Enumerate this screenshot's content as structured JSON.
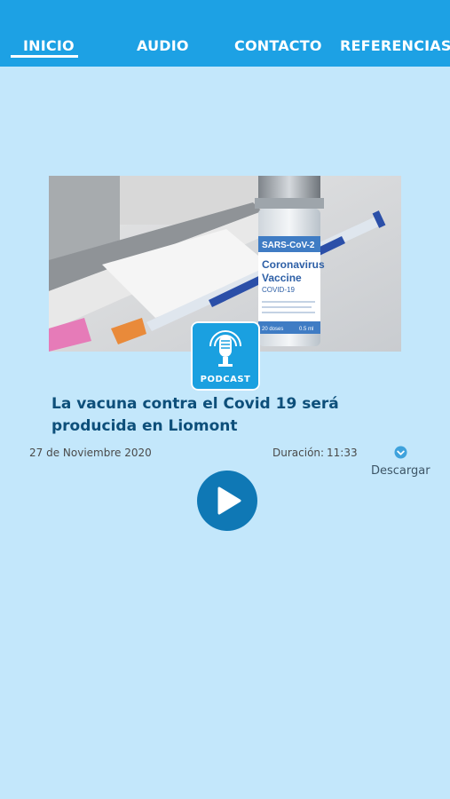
{
  "nav": {
    "items": [
      {
        "label": "INICIO",
        "active": true
      },
      {
        "label": "AUDIO",
        "active": false
      },
      {
        "label": "CONTACTO",
        "active": false
      },
      {
        "label": "REFERENCIAS",
        "active": false
      }
    ]
  },
  "hero": {
    "vial_label_top": "SARS-CoV-2",
    "vial_label_main_1": "Coronavirus",
    "vial_label_main_2": "Vaccine",
    "vial_label_sub": "COVID-19",
    "vial_doses": "20 doses",
    "vial_ml": "0.5 ml"
  },
  "badge": {
    "label": "PODCAST",
    "icon": "microphone-icon"
  },
  "episode": {
    "title": "La vacuna contra el Covid 19 será producida en Liomont",
    "date": "27 de Noviembre 2020",
    "duration_label": "Duración:",
    "duration_value": "11:33",
    "download_label": "Descargar",
    "download_icon": "download-icon",
    "play_icon": "play-icon"
  },
  "colors": {
    "topbar": "#1da1e4",
    "background": "#c3e7fb",
    "title": "#0d4f7a",
    "play": "#0f78b5",
    "badge": "#1aa0e0"
  }
}
